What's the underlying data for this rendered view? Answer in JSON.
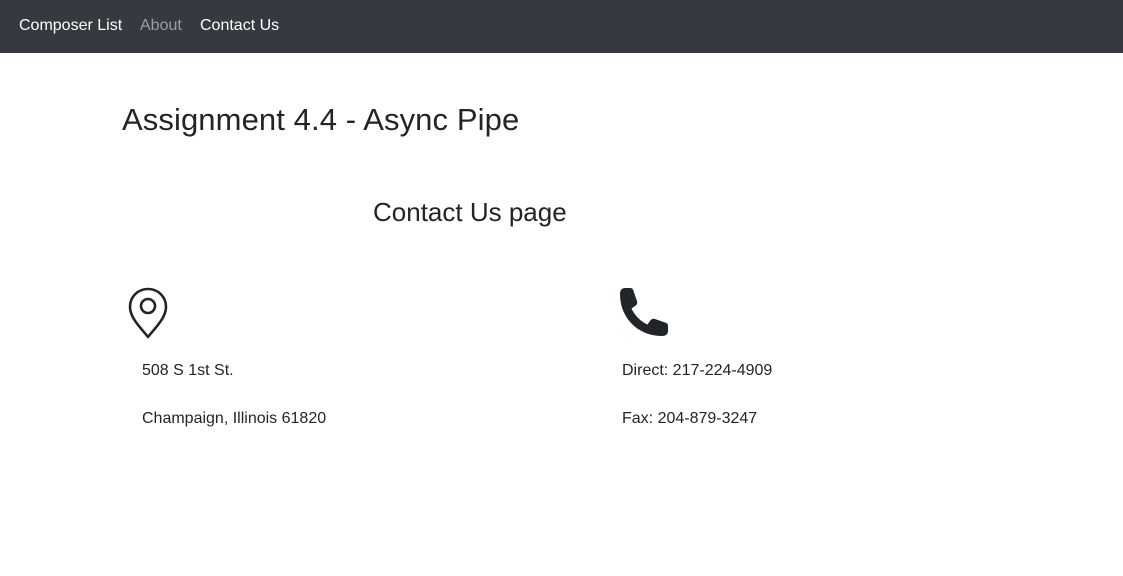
{
  "navbar": {
    "brand": "Composer List",
    "links": [
      {
        "label": "About",
        "state": "inactive"
      },
      {
        "label": "Contact Us",
        "state": "active"
      }
    ]
  },
  "main": {
    "title": "Assignment 4.4 - Async Pipe",
    "subtitle": "Contact Us page"
  },
  "contact": {
    "address": {
      "icon": "location-pin-icon",
      "line1": "508 S 1st St.",
      "line2": "Champaign, Illinois 61820"
    },
    "phone": {
      "icon": "phone-icon",
      "direct": "Direct: 217-224-4909",
      "fax": "Fax: 204-879-3247"
    }
  },
  "colors": {
    "navbar_bg": "#343a40",
    "nav_active": "#ffffff",
    "nav_inactive": "#9a9da0",
    "text": "#212529"
  }
}
